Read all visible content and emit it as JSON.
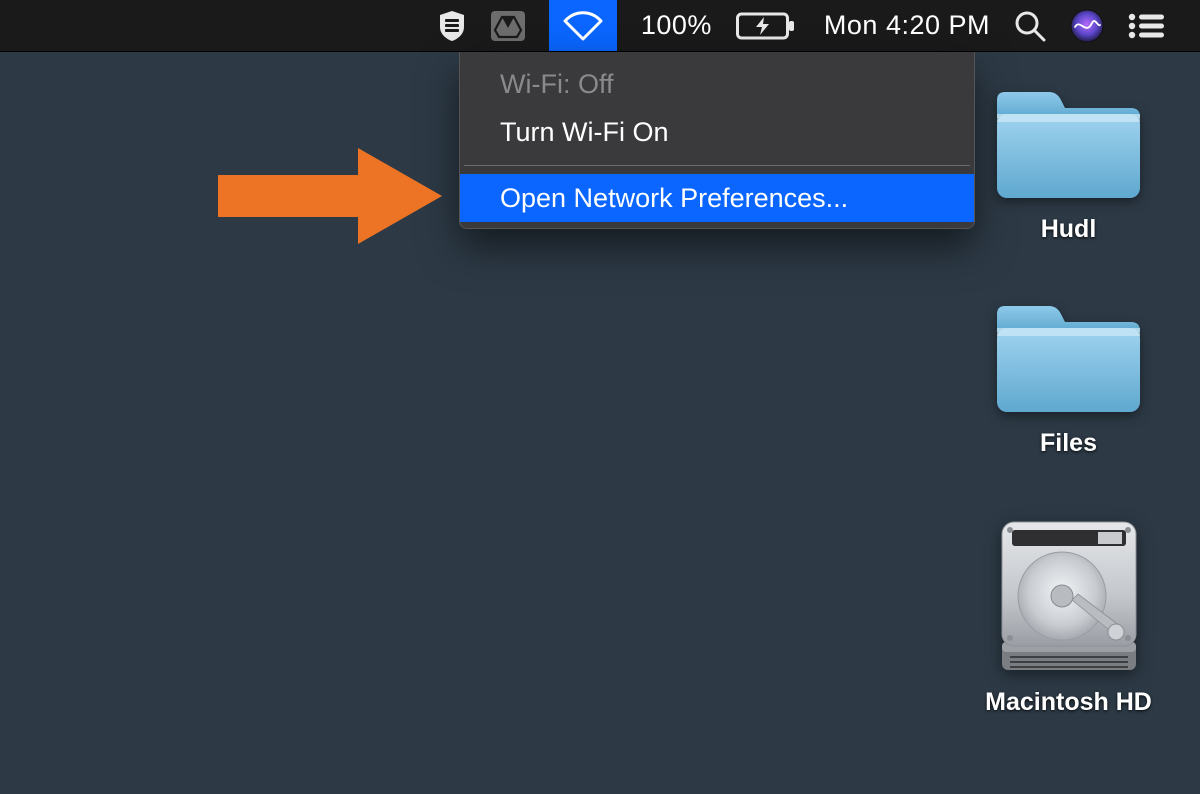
{
  "menubar": {
    "battery_percent": "100%",
    "clock": "Mon 4:20 PM"
  },
  "wifi_menu": {
    "status": "Wi-Fi: Off",
    "toggle_label": "Turn Wi-Fi On",
    "open_prefs_label": "Open Network Preferences..."
  },
  "desktop": {
    "items": [
      {
        "label": "Hudl"
      },
      {
        "label": "Files"
      },
      {
        "label": "Macintosh HD"
      }
    ]
  }
}
